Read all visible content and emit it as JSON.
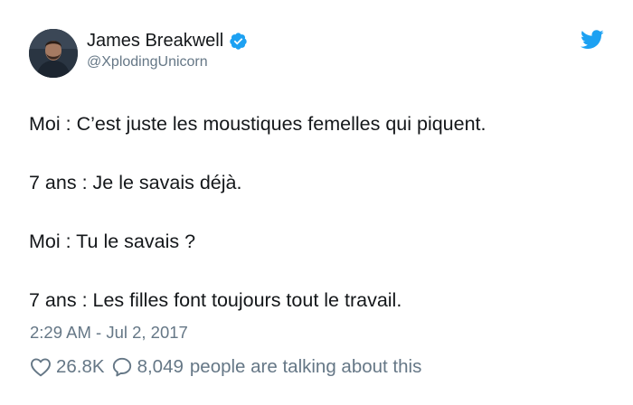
{
  "author": {
    "name": "James Breakwell",
    "handle": "@XplodingUnicorn",
    "verified": true
  },
  "tweet": {
    "lines": [
      "Moi : C’est juste les moustiques femelles qui piquent.",
      "7 ans : Je le savais déjà.",
      "Moi : Tu le savais ?",
      "7 ans : Les filles font toujours tout le travail."
    ],
    "timestamp": "2:29 AM - Jul 2, 2017"
  },
  "footer": {
    "likes": "26.8K",
    "replies": "8,049",
    "talk_label": "people are talking about this"
  },
  "icons": {
    "brand": "twitter-bird-icon",
    "verified": "verified-badge-icon",
    "like": "heart-icon",
    "reply": "speech-bubble-icon"
  },
  "colors": {
    "text_primary": "#14171a",
    "text_secondary": "#657786",
    "twitter_blue": "#1da1f2"
  }
}
